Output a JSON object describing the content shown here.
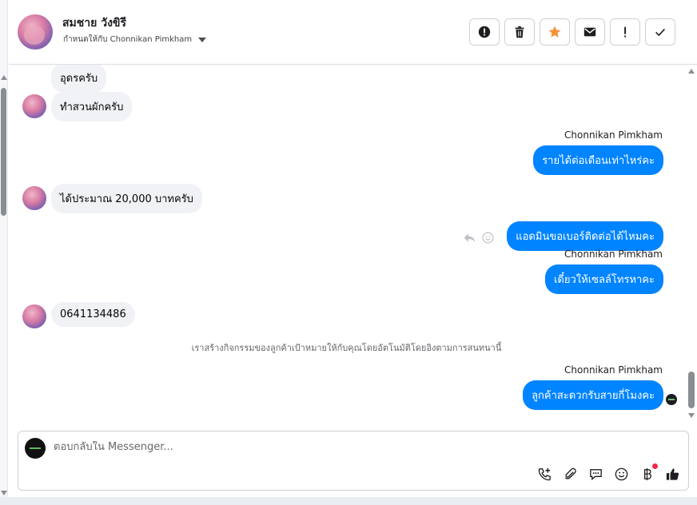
{
  "header": {
    "contact_name": "สมชาย วังขิรี",
    "assigned_label": "กำหนดให้กับ Chonnikan Pimkham",
    "actions": [
      {
        "name": "spam",
        "icon": "alert-circle-icon"
      },
      {
        "name": "delete",
        "icon": "trash-icon"
      },
      {
        "name": "star",
        "icon": "star-icon"
      },
      {
        "name": "mark-unread",
        "icon": "envelope-icon"
      },
      {
        "name": "follow-up",
        "icon": "exclamation-icon"
      },
      {
        "name": "done",
        "icon": "check-icon"
      }
    ],
    "star_color": "#f7923a"
  },
  "messages": [
    {
      "dir": "in",
      "text": "อุดรครับ"
    },
    {
      "dir": "in",
      "text": "ทำสวนผักครับ"
    },
    {
      "dir": "out",
      "sender": "Chonnikan Pimkham",
      "text": "รายได้ต่อเดือนเท่าไหร่คะ"
    },
    {
      "dir": "in",
      "text": "ได้ประมาณ 20,000 บาทครับ"
    },
    {
      "dir": "out",
      "text": "แอดมินขอเบอร์ติดต่อได้ไหมคะ"
    },
    {
      "dir": "out",
      "sender": "Chonnikan Pimkham",
      "text": "เดี๋ยวให้เซลล์โทรหาคะ"
    },
    {
      "dir": "in",
      "text": "0641134486"
    },
    {
      "dir": "out",
      "sender": "Chonnikan Pimkham",
      "text": "ลูกค้าสะดวกรับสายกี่โมงคะ"
    }
  ],
  "system_note": "เราสร้างกิจกรรมของลูกค้าเป้าหมายให้กับคุณโดยอัตโนมัติโดยอิงตามการสนทนานี้",
  "composer": {
    "placeholder": "ตอบกลับใน Messenger...",
    "tools": [
      "phone-plus-icon",
      "paperclip-icon",
      "saved-reply-icon",
      "emoji-icon",
      "baht-icon",
      "thumbs-up-icon"
    ]
  },
  "colors": {
    "outgoing_bubble": "#0084ff",
    "incoming_bubble": "#f0f2f5"
  }
}
